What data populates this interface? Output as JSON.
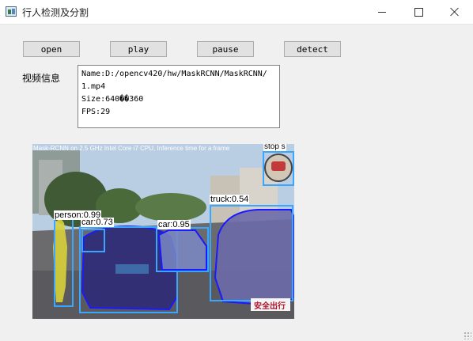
{
  "window": {
    "title": "行人检测及分割"
  },
  "toolbar": {
    "open_label": "open",
    "play_label": "play",
    "pause_label": "pause",
    "detect_label": "detect"
  },
  "info": {
    "label": "视频信息",
    "lines": [
      "Name:D:/opencv420/hw/MaskRCNN/MaskRCNN/",
      "1.mp4",
      "Size:640��360",
      "FPS:29"
    ]
  },
  "video": {
    "overlay_text": "Mask-RCNN on 2.5 GHz Intel Core i7 CPU, Inference time for a frame",
    "detections": [
      {
        "label": "person:0.99",
        "color": "#39a7ff"
      },
      {
        "label": "car:0.73",
        "color": "#39a7ff"
      },
      {
        "label": "car:0.95",
        "color": "#39a7ff"
      },
      {
        "label": "truck:0.54",
        "color": "#39a7ff"
      },
      {
        "label": "stop s",
        "color": "#39a7ff"
      }
    ],
    "watermark": "安全出行"
  }
}
